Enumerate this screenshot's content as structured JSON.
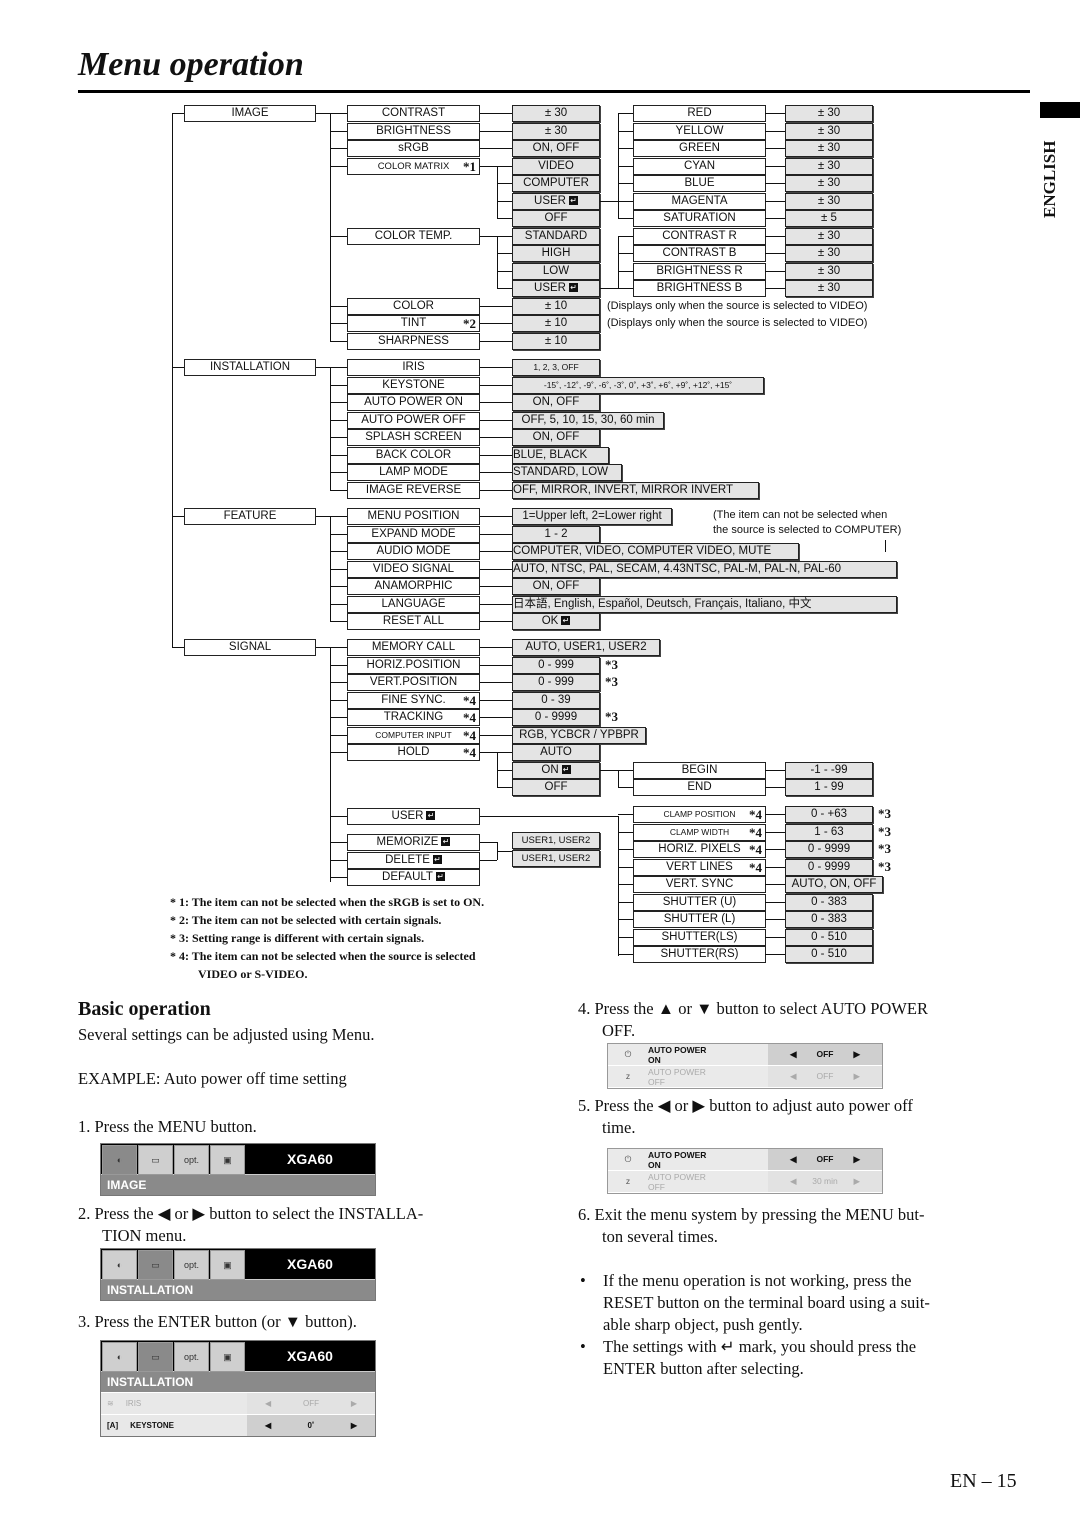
{
  "page": {
    "title": "Menu operation",
    "language_tab": "ENGLISH",
    "page_number": "EN – 15"
  },
  "enter_symbol": "↵",
  "menu_tree": {
    "image": {
      "label": "IMAGE",
      "items": [
        {
          "label": "CONTRAST",
          "value": "± 30"
        },
        {
          "label": "BRIGHTNESS",
          "value": "± 30"
        },
        {
          "label": "sRGB",
          "value": "ON, OFF"
        },
        {
          "label": "COLOR MATRIX",
          "mark": "*1",
          "options": [
            "VIDEO",
            "COMPUTER",
            "USER",
            "OFF"
          ]
        },
        {
          "label": "COLOR TEMP.",
          "options": [
            "STANDARD",
            "HIGH",
            "LOW",
            "USER"
          ]
        },
        {
          "label": "COLOR",
          "value": "± 10",
          "hint": "(Displays only when the source is selected to VIDEO)"
        },
        {
          "label": "TINT",
          "mark": "*2",
          "value": "± 10",
          "hint": "(Displays only when the source is selected to VIDEO)"
        },
        {
          "label": "SHARPNESS",
          "value": "± 10"
        }
      ],
      "color_matrix_user": [
        {
          "label": "RED",
          "value": "± 30"
        },
        {
          "label": "YELLOW",
          "value": "± 30"
        },
        {
          "label": "GREEN",
          "value": "± 30"
        },
        {
          "label": "CYAN",
          "value": "± 30"
        },
        {
          "label": "BLUE",
          "value": "± 30"
        },
        {
          "label": "MAGENTA",
          "value": "± 30"
        },
        {
          "label": "SATURATION",
          "value": "± 5"
        }
      ],
      "color_temp_user": [
        {
          "label": "CONTRAST R",
          "value": "± 30"
        },
        {
          "label": "CONTRAST B",
          "value": "± 30"
        },
        {
          "label": "BRIGHTNESS R",
          "value": "± 30"
        },
        {
          "label": "BRIGHTNESS B",
          "value": "± 30"
        }
      ]
    },
    "installation": {
      "label": "INSTALLATION",
      "items": [
        {
          "label": "IRIS",
          "value": "1, 2, 3, OFF"
        },
        {
          "label": "KEYSTONE",
          "value": "-15˚, -12˚, -9˚, -6˚, -3˚, 0˚, +3˚, +6˚, +9˚, +12˚, +15˚"
        },
        {
          "label": "AUTO POWER ON",
          "value": "ON, OFF"
        },
        {
          "label": "AUTO POWER OFF",
          "value": "OFF, 5, 10, 15, 30, 60 min"
        },
        {
          "label": "SPLASH SCREEN",
          "value": "ON, OFF"
        },
        {
          "label": "BACK COLOR",
          "value": "BLUE, BLACK"
        },
        {
          "label": "LAMP MODE",
          "value": "STANDARD, LOW"
        },
        {
          "label": "IMAGE REVERSE",
          "value": "OFF, MIRROR, INVERT, MIRROR INVERT"
        }
      ]
    },
    "feature": {
      "label": "FEATURE",
      "hint": [
        "(The item can not be selected when",
        "the source is selected to COMPUTER)"
      ],
      "items": [
        {
          "label": "MENU POSITION",
          "value": "1=Upper left, 2=Lower right"
        },
        {
          "label": "EXPAND MODE",
          "value": "1 - 2"
        },
        {
          "label": "AUDIO MODE",
          "value": "COMPUTER, VIDEO, COMPUTER VIDEO, MUTE"
        },
        {
          "label": "VIDEO SIGNAL",
          "value": "AUTO, NTSC, PAL, SECAM, 4.43NTSC, PAL-M, PAL-N, PAL-60"
        },
        {
          "label": "ANAMORPHIC",
          "value": "ON, OFF"
        },
        {
          "label": "LANGUAGE",
          "value": "日本語, English, Español, Deutsch, Français, Italiano, 中文"
        },
        {
          "label": "RESET ALL",
          "value": "OK"
        }
      ]
    },
    "signal": {
      "label": "SIGNAL",
      "items": [
        {
          "label": "MEMORY CALL",
          "value": "AUTO, USER1, USER2"
        },
        {
          "label": "HORIZ.POSITION",
          "value": "0 - 999",
          "value_mark": "*3"
        },
        {
          "label": "VERT.POSITION",
          "value": "0 - 999",
          "value_mark": "*3"
        },
        {
          "label": "FINE SYNC.",
          "mark": "*4",
          "value": "0 - 39"
        },
        {
          "label": "TRACKING",
          "mark": "*4",
          "value": "0 - 9999",
          "value_mark": "*3"
        },
        {
          "label": "COMPUTER INPUT",
          "mark": "*4",
          "value": "RGB, YCBCR / YPBPR"
        },
        {
          "label": "HOLD",
          "mark": "*4",
          "options": [
            "AUTO",
            "ON",
            "OFF"
          ]
        }
      ],
      "hold_on": [
        {
          "label": "BEGIN",
          "value": "-1 - -99"
        },
        {
          "label": "END",
          "value": "1 - 99"
        }
      ],
      "user_label": "USER",
      "user_items": [
        {
          "label": "CLAMP POSITION",
          "mark": "*4",
          "value": "0 - +63",
          "value_mark": "*3"
        },
        {
          "label": "CLAMP WIDTH",
          "mark": "*4",
          "value": "1 - 63",
          "value_mark": "*3"
        },
        {
          "label": "HORIZ. PIXELS",
          "mark": "*4",
          "value": "0 - 9999",
          "value_mark": "*3"
        },
        {
          "label": "VERT LINES",
          "mark": "*4",
          "value": "0 - 9999",
          "value_mark": "*3"
        },
        {
          "label": "VERT. SYNC",
          "value": "AUTO, ON, OFF"
        },
        {
          "label": "SHUTTER (U)",
          "value": "0 - 383"
        },
        {
          "label": "SHUTTER (L)",
          "value": "0 - 383"
        },
        {
          "label": "SHUTTER(LS)",
          "value": "0 - 510"
        },
        {
          "label": "SHUTTER(RS)",
          "value": "0 - 510"
        }
      ],
      "memory_items": [
        {
          "label": "MEMORIZE",
          "value": "USER1, USER2"
        },
        {
          "label": "DELETE",
          "value": "USER1, USER2"
        },
        {
          "label": "DEFAULT"
        }
      ]
    }
  },
  "footnotes": [
    "* 1: The item can not be selected when the sRGB is set to ON.",
    "* 2: The item can not be selected with certain signals.",
    "* 3: Setting range is different with certain signals.",
    "* 4: The item can not be selected when the source is selected",
    "VIDEO or S-VIDEO."
  ],
  "basic": {
    "heading": "Basic operation",
    "intro": "Several settings can be adjusted using Menu.",
    "example": "EXAMPLE: Auto power off time setting",
    "steps": [
      "1.  Press the MENU button.",
      "2.  Press the ◀ or ▶ button to select the INSTALLA-",
      "TION menu.",
      "3.  Press the ENTER button (or ▼ button).",
      "4.  Press the ▲ or ▼ button to select AUTO POWER",
      "OFF.",
      "5.  Press the ◀ or ▶ button to adjust auto power off",
      "time.",
      "6.  Exit the menu system by pressing the MENU but-",
      "ton several times."
    ],
    "bullets": [
      "If the menu operation is not working, press the",
      "RESET button on the terminal board using a suit-",
      "able sharp object, push gently.",
      "The settings with ↵ mark, you should press the",
      "ENTER button after selecting."
    ]
  },
  "osd": {
    "model": "XGA60",
    "icons": [
      "image-icon",
      "installation-icon",
      "feature-opt-icon",
      "signal-icon"
    ],
    "opt_label": "opt.",
    "screens": [
      {
        "tab": "IMAGE"
      },
      {
        "tab": "INSTALLATION"
      },
      {
        "tab": "INSTALLATION",
        "rows": [
          {
            "label": "IRIS",
            "value": "OFF",
            "dim": true
          },
          {
            "label": "KEYSTONE",
            "value": "0˚",
            "dim": false
          }
        ]
      }
    ],
    "auto_power_screens": [
      {
        "rows": [
          {
            "label1": "AUTO POWER",
            "label2": "ON",
            "value": "OFF"
          },
          {
            "label1": "AUTO POWER",
            "label2": "OFF",
            "value": "OFF"
          }
        ]
      },
      {
        "rows": [
          {
            "label1": "AUTO POWER",
            "label2": "ON",
            "value": "OFF"
          },
          {
            "label1": "AUTO POWER",
            "label2": "OFF",
            "value": "30 min"
          }
        ]
      }
    ]
  }
}
